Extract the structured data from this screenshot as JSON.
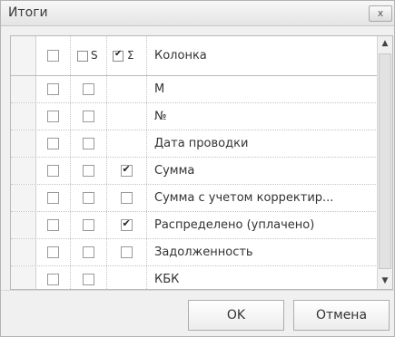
{
  "window": {
    "title": "Итоги",
    "close_glyph": "x"
  },
  "grid": {
    "header": {
      "col_s_label": "S",
      "col_sum_label": "Σ",
      "col_name_label": "Колонка"
    },
    "rows": [
      {
        "name": "М",
        "sum_visible": false,
        "sum_checked": false
      },
      {
        "name": "№",
        "sum_visible": false,
        "sum_checked": false
      },
      {
        "name": "Дата проводки",
        "sum_visible": false,
        "sum_checked": false
      },
      {
        "name": "Сумма",
        "sum_visible": true,
        "sum_checked": true
      },
      {
        "name": "Сумма с учетом корректир...",
        "sum_visible": true,
        "sum_checked": false
      },
      {
        "name": "Распределено (уплачено)",
        "sum_visible": true,
        "sum_checked": true
      },
      {
        "name": "Задолженность",
        "sum_visible": true,
        "sum_checked": false
      },
      {
        "name": "КБК",
        "sum_visible": false,
        "sum_checked": false
      }
    ]
  },
  "scrollbar": {
    "up_icon": "▲",
    "down_icon": "▼"
  },
  "buttons": {
    "ok_label": "OK",
    "cancel_label": "Отмена"
  }
}
